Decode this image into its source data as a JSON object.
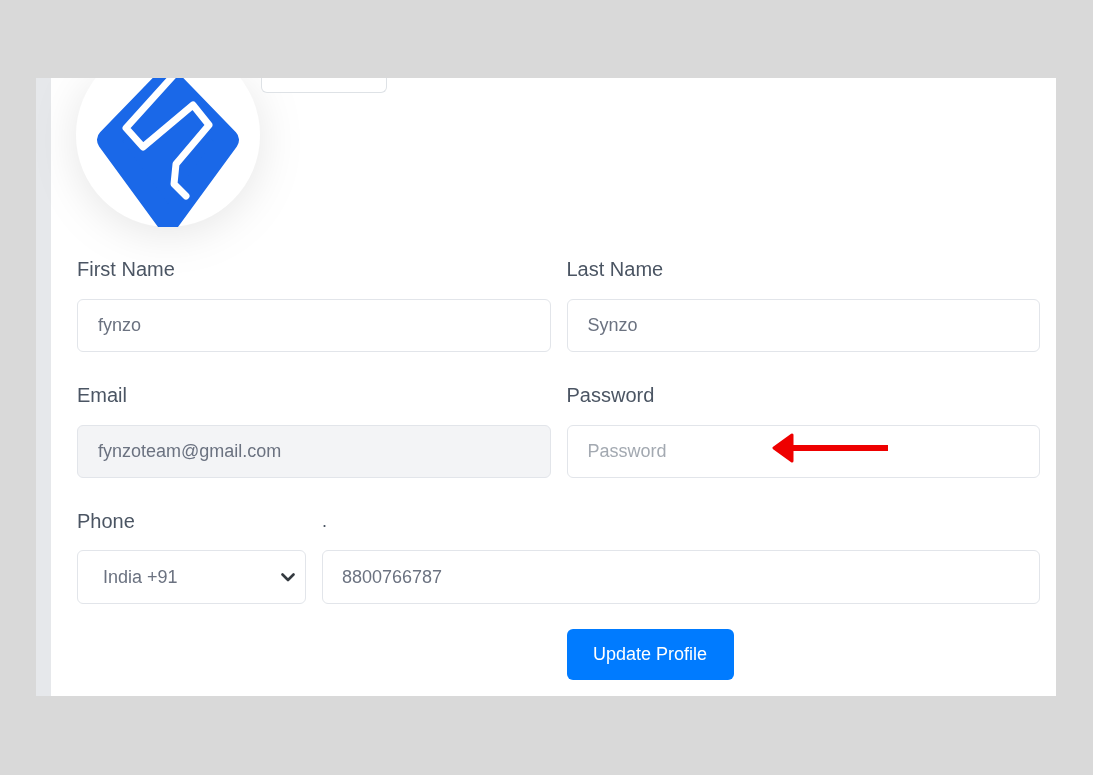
{
  "form": {
    "fields": [
      {
        "label": "First Name",
        "value": "fynzo",
        "disabled": false,
        "pointer_arrow": false
      },
      {
        "label": "Last Name",
        "value": "Synzo",
        "disabled": false,
        "pointer_arrow": false
      },
      {
        "label": "Email",
        "value": "fynzoteam@gmail.com",
        "disabled": true,
        "pointer_arrow": false
      },
      {
        "label": "Password",
        "placeholder": "Password",
        "disabled": false,
        "pointer_arrow": true
      }
    ],
    "phone": {
      "label": "Phone",
      "number_label": ".",
      "country": "India +91",
      "number": "8800766787"
    },
    "submit_button": "Update Profile"
  }
}
